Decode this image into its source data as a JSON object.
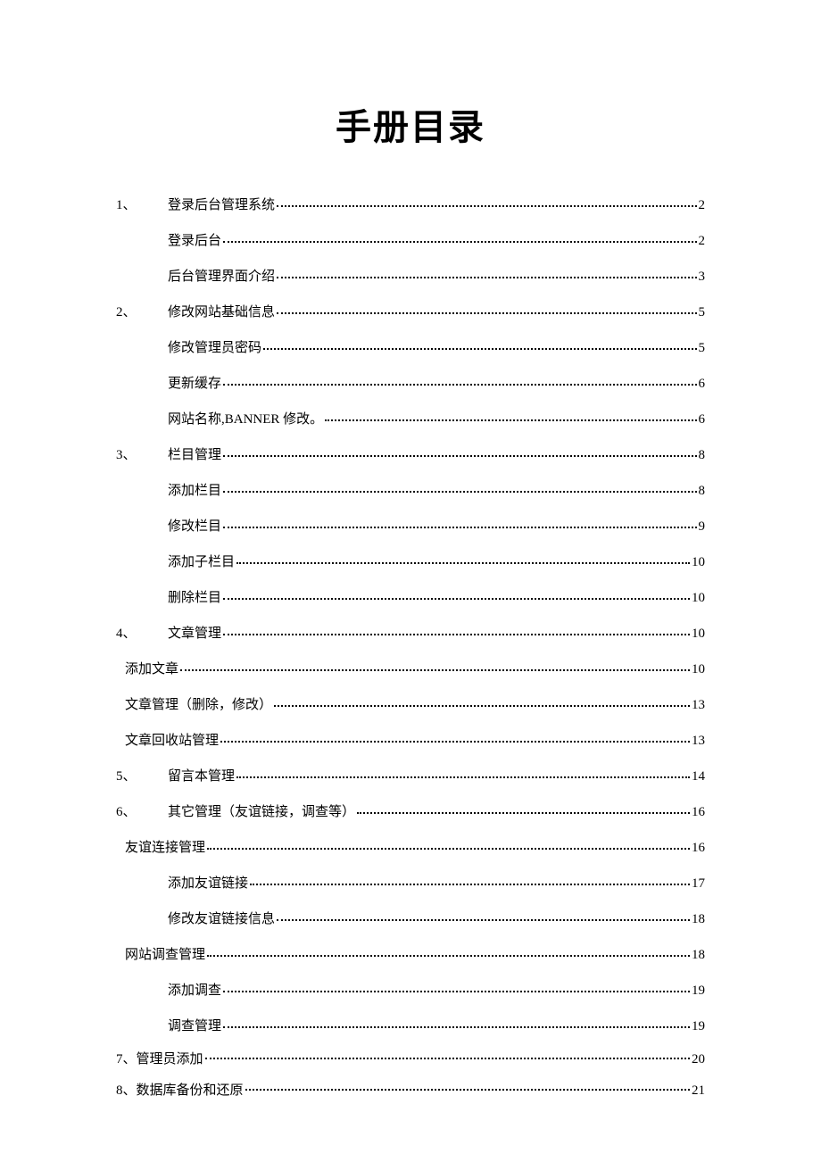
{
  "title": "手册目录",
  "entries": [
    {
      "num": "1、",
      "indent": "main",
      "label": "登录后台管理系统",
      "page": "2"
    },
    {
      "num": "",
      "indent": "sub",
      "label": "登录后台",
      "page": "2"
    },
    {
      "num": "",
      "indent": "sub",
      "label": "后台管理界面介绍",
      "page": "3"
    },
    {
      "num": "2、",
      "indent": "main",
      "label": "修改网站基础信息",
      "page": "5"
    },
    {
      "num": "",
      "indent": "sub",
      "label": "修改管理员密码",
      "page": "5"
    },
    {
      "num": "",
      "indent": "sub",
      "label": "更新缓存",
      "page": "6"
    },
    {
      "num": "",
      "indent": "sub",
      "label": "网站名称,BANNER 修改。",
      "page": "6"
    },
    {
      "num": "3、",
      "indent": "main",
      "label": "栏目管理",
      "page": "8"
    },
    {
      "num": "",
      "indent": "sub",
      "label": "添加栏目",
      "page": "8"
    },
    {
      "num": "",
      "indent": "sub",
      "label": "修改栏目",
      "page": "9"
    },
    {
      "num": "",
      "indent": "sub",
      "label": "添加子栏目",
      "page": "10"
    },
    {
      "num": "",
      "indent": "sub",
      "label": "删除栏目",
      "page": "10"
    },
    {
      "num": "4、",
      "indent": "main",
      "label": "文章管理",
      "page": "10"
    },
    {
      "num": "",
      "indent": "flush",
      "label": "添加文章",
      "page": "10"
    },
    {
      "num": "",
      "indent": "flush",
      "label": "文章管理（删除，修改）",
      "page": "13"
    },
    {
      "num": "",
      "indent": "flush",
      "label": "文章回收站管理",
      "page": "13"
    },
    {
      "num": "5、",
      "indent": "main",
      "label": "留言本管理",
      "page": "14"
    },
    {
      "num": "6、",
      "indent": "main",
      "label": "其它管理（友谊链接，调查等）",
      "page": "16"
    },
    {
      "num": "",
      "indent": "flush",
      "label": "友谊连接管理",
      "page": "16"
    },
    {
      "num": "",
      "indent": "sub",
      "label": "添加友谊链接",
      "page": "17"
    },
    {
      "num": "",
      "indent": "sub",
      "label": "修改友谊链接信息",
      "page": "18"
    },
    {
      "num": "",
      "indent": "flush",
      "label": "网站调查管理",
      "page": "18"
    },
    {
      "num": "",
      "indent": "sub",
      "label": "添加调查",
      "page": "19"
    },
    {
      "num": "",
      "indent": "sub",
      "label": "调查管理",
      "page": "19"
    },
    {
      "num": "7、",
      "indent": "tight",
      "label": "管理员添加",
      "page": "20"
    },
    {
      "num": "8、",
      "indent": "tight",
      "label": "数据库备份和还原",
      "page": "21"
    }
  ]
}
